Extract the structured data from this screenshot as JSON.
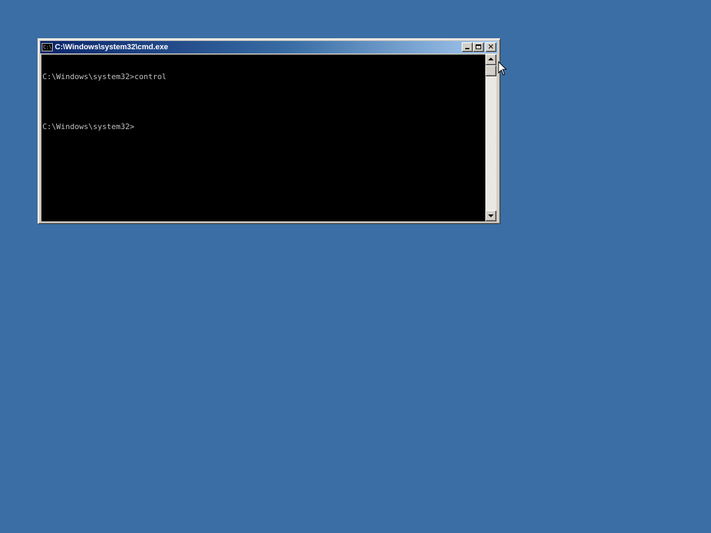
{
  "window": {
    "title": "C:\\Windows\\system32\\cmd.exe",
    "icon_text": "C:\\",
    "icon": "console-icon",
    "buttons": {
      "minimize": "minimize-icon",
      "maximize": "maximize-icon",
      "close": "close-icon",
      "close_glyph": "✕"
    }
  },
  "console": {
    "lines": [
      "C:\\Windows\\system32>control",
      "",
      "C:\\Windows\\system32>"
    ]
  },
  "colors": {
    "desktop": "#3a6ea5",
    "console_bg": "#000000",
    "console_text": "#c0c0c0"
  }
}
